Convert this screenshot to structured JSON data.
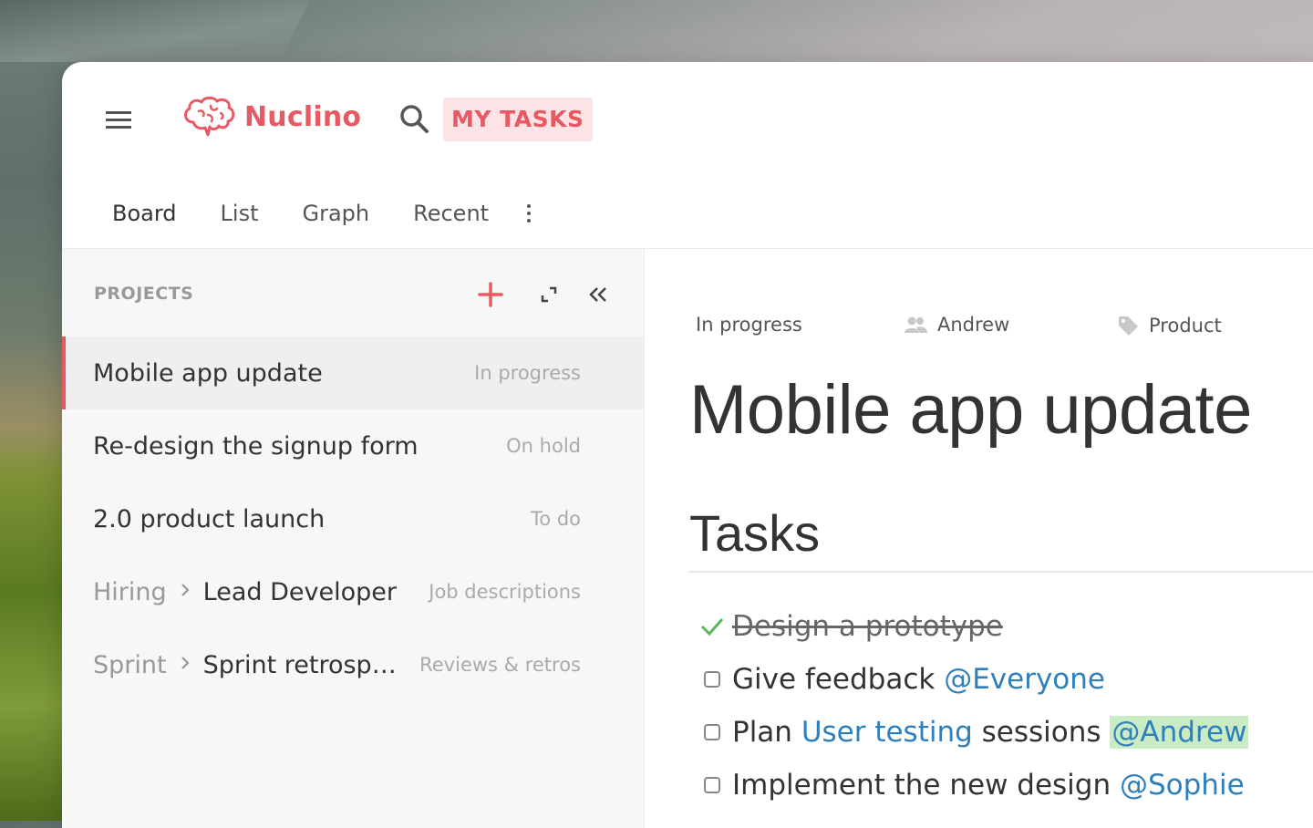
{
  "app": {
    "name": "Nuclino",
    "brand_color": "#e85a63"
  },
  "header": {
    "my_tasks_label": "MY TASKS"
  },
  "tabs": [
    {
      "label": "Board",
      "active": true
    },
    {
      "label": "List",
      "active": false
    },
    {
      "label": "Graph",
      "active": false
    },
    {
      "label": "Recent",
      "active": false
    }
  ],
  "sidebar": {
    "title": "PROJECTS",
    "items": [
      {
        "title": "Mobile app update",
        "status": "In progress",
        "selected": true
      },
      {
        "title": "Re-design the signup form",
        "status": "On hold"
      },
      {
        "title": "2.0 product launch",
        "status": "To do"
      },
      {
        "parent": "Hiring",
        "title": "Lead Developer",
        "status": "Job descriptions"
      },
      {
        "parent": "Sprint",
        "title": "Sprint retrospective",
        "status": "Reviews & retros"
      }
    ]
  },
  "document": {
    "status": "In progress",
    "assignee": "Andrew",
    "tag": "Product",
    "title": "Mobile app update",
    "section_heading": "Tasks",
    "tasks": [
      {
        "done": true,
        "text": "Design a prototype"
      },
      {
        "done": false,
        "text": "Give feedback",
        "mention": "@Everyone"
      },
      {
        "done": false,
        "text_before": "Plan",
        "link": "User testing",
        "text_after": "sessions",
        "mention": "@Andrew"
      },
      {
        "done": false,
        "text": "Implement the new design",
        "mention": "@Sophie"
      }
    ]
  }
}
